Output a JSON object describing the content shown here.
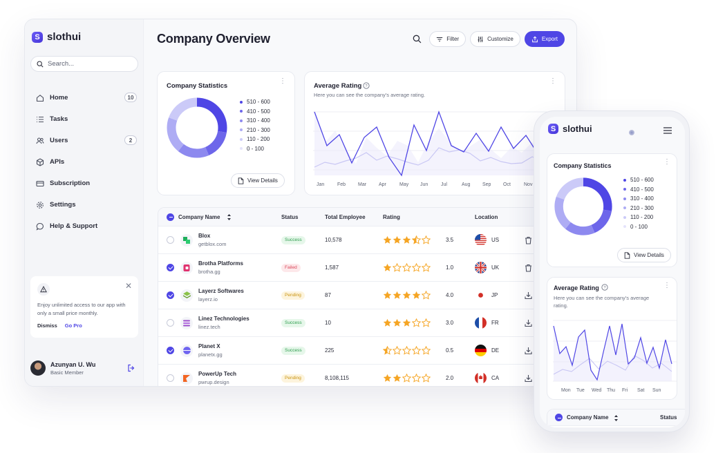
{
  "app": {
    "name": "slothui",
    "logo_letter": "S"
  },
  "sidebar": {
    "search_placeholder": "Search...",
    "items": [
      {
        "label": "Home",
        "icon": "home-icon",
        "badge": "10"
      },
      {
        "label": "Tasks",
        "icon": "list-icon",
        "badge": ""
      },
      {
        "label": "Users",
        "icon": "users-icon",
        "badge": "2"
      },
      {
        "label": "APIs",
        "icon": "cube-icon",
        "badge": ""
      },
      {
        "label": "Subscription",
        "icon": "card-icon",
        "badge": ""
      },
      {
        "label": "Settings",
        "icon": "gear-icon",
        "badge": ""
      },
      {
        "label": "Help & Support",
        "icon": "chat-icon",
        "badge": ""
      }
    ],
    "promo": {
      "text": "Enjoy unlimited access to our app with only a small price monthly.",
      "dismiss": "Dismiss",
      "go_pro": "Go Pro"
    },
    "user": {
      "name": "Azunyan U. Wu",
      "role": "Basic Member"
    }
  },
  "header": {
    "title": "Company Overview",
    "filter": "Filter",
    "customize": "Customize",
    "export": "Export"
  },
  "stats_card": {
    "title": "Company Statistics",
    "legend": [
      "510 - 600",
      "410 - 500",
      "310 - 400",
      "210 - 300",
      "110 - 200",
      "0 - 100"
    ],
    "view_details": "View Details"
  },
  "rating_card": {
    "title": "Average Rating",
    "subtitle": "Here you can see the company's average rating.",
    "months": [
      "Jan",
      "Feb",
      "Mar",
      "Apr",
      "May",
      "Jun",
      "Jul",
      "Aug",
      "Sep",
      "Oct",
      "Nov"
    ],
    "days": [
      "Mon",
      "Tue",
      "Wed",
      "Thu",
      "Fri",
      "Sat",
      "Sun"
    ]
  },
  "table": {
    "headers": {
      "company": "Company Name",
      "status": "Status",
      "employees": "Total Employee",
      "rating": "Rating",
      "location": "Location"
    },
    "rows": [
      {
        "name": "Blox",
        "domain": "getblox.com",
        "status": "Success",
        "employees": "10,578",
        "rating": "3.5",
        "location": "US",
        "checked": false
      },
      {
        "name": "Brotha Platforms",
        "domain": "brotha.gg",
        "status": "Failed",
        "employees": "1,587",
        "rating": "1.0",
        "location": "UK",
        "checked": true
      },
      {
        "name": "Layerz Softwares",
        "domain": "layerz.io",
        "status": "Pending",
        "employees": "87",
        "rating": "4.0",
        "location": "JP",
        "checked": true
      },
      {
        "name": "Linez Technologies",
        "domain": "linez.tech",
        "status": "Success",
        "employees": "10",
        "rating": "3.0",
        "location": "FR",
        "checked": false
      },
      {
        "name": "Planet X",
        "domain": "planetx.gg",
        "status": "Success",
        "employees": "225",
        "rating": "0.5",
        "location": "DE",
        "checked": true
      },
      {
        "name": "PowerUp Tech",
        "domain": "pwrup.design",
        "status": "Pending",
        "employees": "8,108,115",
        "rating": "2.0",
        "location": "CA",
        "checked": false
      }
    ]
  },
  "mobile": {
    "table_header_company": "Company Name",
    "table_header_status": "Status"
  },
  "colors": {
    "accent": "#4f46e5",
    "star": "#f5a524"
  }
}
